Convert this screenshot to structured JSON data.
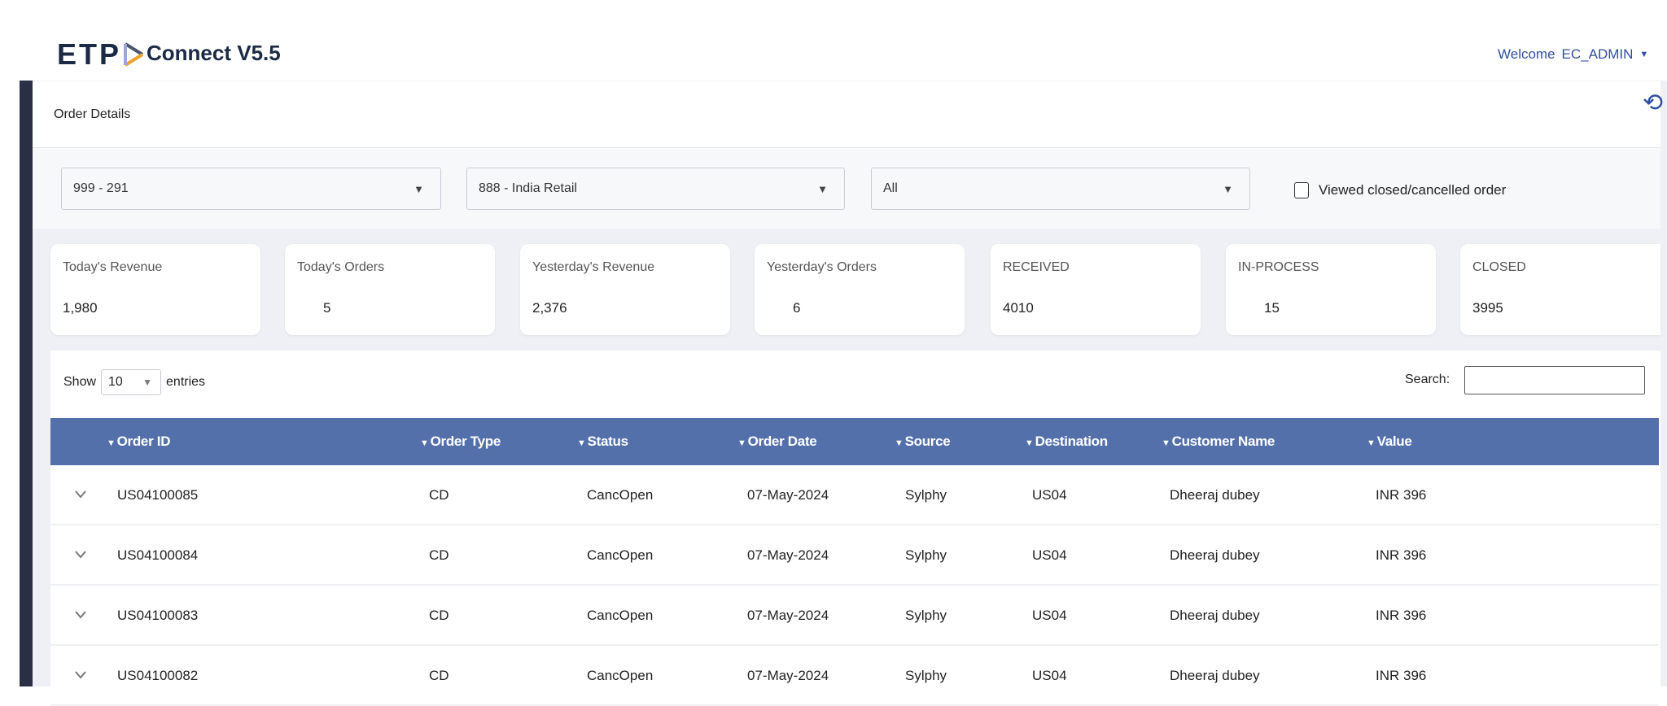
{
  "header": {
    "logo_text": "ETP",
    "app_title": "Connect V5.5",
    "welcome": "Welcome",
    "user": "EC_ADMIN"
  },
  "page": {
    "title": "Order Details"
  },
  "filters": {
    "store": "999 - 291",
    "channel": "888 - India Retail",
    "status": "All",
    "checkbox_label": "Viewed closed/cancelled order"
  },
  "kpis": [
    {
      "label": "Today's Revenue",
      "value": "1,980"
    },
    {
      "label": "Today's Orders",
      "value": "5"
    },
    {
      "label": "Yesterday's Revenue",
      "value": "2,376"
    },
    {
      "label": "Yesterday's Orders",
      "value": "6"
    },
    {
      "label": "RECEIVED",
      "value": "4010"
    },
    {
      "label": "IN-PROCESS",
      "value": "15"
    },
    {
      "label": "CLOSED",
      "value": "3995"
    }
  ],
  "table": {
    "show": "Show",
    "entries_value": "10",
    "entries": "entries",
    "search_label": "Search:",
    "columns": [
      "Order ID",
      "Order Type",
      "Status",
      "Order Date",
      "Source",
      "Destination",
      "Customer Name",
      "Value"
    ],
    "rows": [
      [
        "US04100085",
        "CD",
        "CancOpen",
        "07-May-2024",
        "Sylphy",
        "US04",
        "Dheeraj dubey",
        "INR 396"
      ],
      [
        "US04100084",
        "CD",
        "CancOpen",
        "07-May-2024",
        "Sylphy",
        "US04",
        "Dheeraj dubey",
        "INR 396"
      ],
      [
        "US04100083",
        "CD",
        "CancOpen",
        "07-May-2024",
        "Sylphy",
        "US04",
        "Dheeraj dubey",
        "INR 396"
      ],
      [
        "US04100082",
        "CD",
        "CancOpen",
        "07-May-2024",
        "Sylphy",
        "US04",
        "Dheeraj dubey",
        "INR 396"
      ]
    ]
  },
  "colors": {
    "header_bg": "#5470ab",
    "accent": "#2f4fa0",
    "sidebar": "#2a2f45",
    "logo_orange": "#f0a030"
  }
}
